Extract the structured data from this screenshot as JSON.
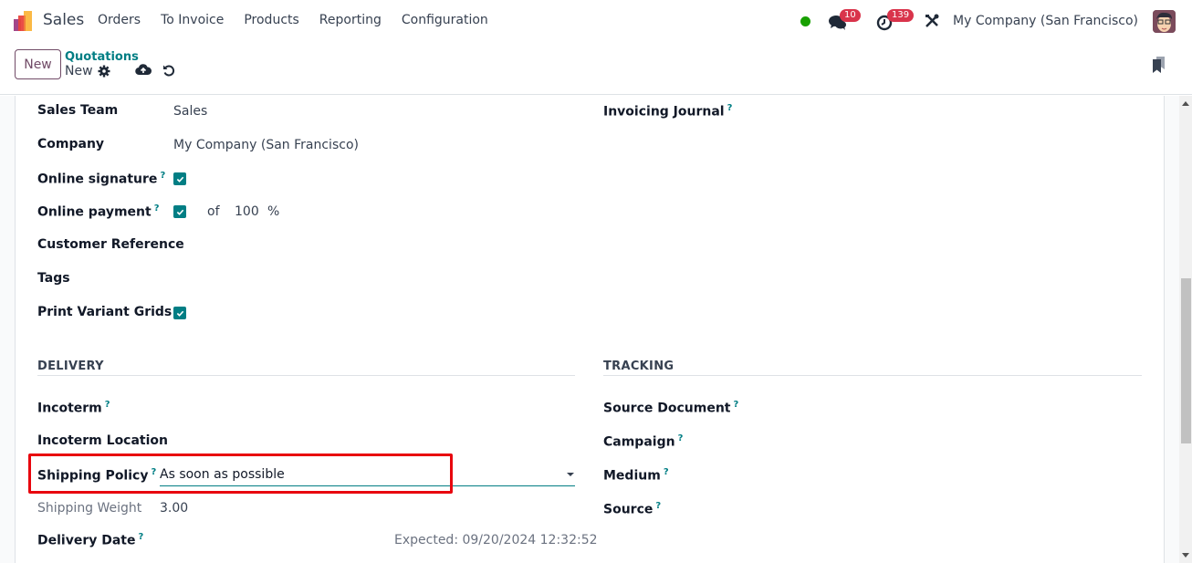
{
  "navbar": {
    "app_name": "Sales",
    "menu": [
      "Orders",
      "To Invoice",
      "Products",
      "Reporting",
      "Configuration"
    ],
    "messages_count": "10",
    "activities_count": "139",
    "company": "My Company (San Francisco)",
    "presence_color": "#18a000"
  },
  "control_panel": {
    "new_button": "New",
    "breadcrumb": "Quotations",
    "record_name": "New"
  },
  "form": {
    "left_fields": [
      {
        "label": "Sales Team",
        "value": "Sales"
      },
      {
        "label": "Company",
        "value": "My Company (San Francisco)"
      },
      {
        "label": "Online signature",
        "help": "?",
        "checked": true
      },
      {
        "label": "Online payment",
        "help": "?",
        "checked": true,
        "of": "of",
        "percent_value": "100",
        "percent_sign": "%"
      },
      {
        "label": "Customer Reference",
        "value": ""
      },
      {
        "label": "Tags",
        "value": ""
      },
      {
        "label": "Print Variant Grids",
        "checked": true
      }
    ],
    "right_fields": [
      {
        "label": "Invoicing Journal",
        "help": "?"
      }
    ],
    "delivery": {
      "title": "DELIVERY",
      "incoterm": "Incoterm",
      "incoterm_help": "?",
      "incoterm_location": "Incoterm Location",
      "shipping_policy": "Shipping Policy",
      "shipping_policy_help": "?",
      "shipping_policy_value": "As soon as possible",
      "shipping_weight": "Shipping Weight",
      "shipping_weight_value": "3.00",
      "delivery_date": "Delivery Date",
      "delivery_date_help": "?",
      "expected": "Expected: 09/20/2024 12:32:52"
    },
    "tracking": {
      "title": "TRACKING",
      "fields": [
        {
          "label": "Source Document",
          "help": "?"
        },
        {
          "label": "Campaign",
          "help": "?"
        },
        {
          "label": "Medium",
          "help": "?"
        },
        {
          "label": "Source",
          "help": "?"
        }
      ]
    }
  },
  "colors": {
    "accent": "#017e84",
    "brand": "#714b67",
    "highlight": "#e8060e",
    "badge": "#d9344b"
  }
}
